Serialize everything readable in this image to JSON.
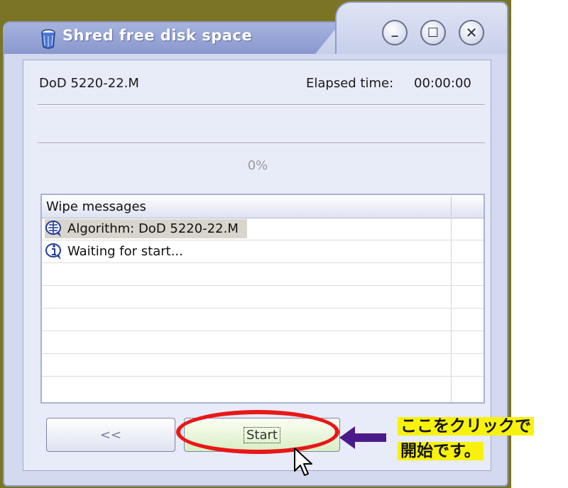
{
  "window": {
    "title": "Shred free disk space",
    "controls": {
      "minimize": "_",
      "maximize": "☐",
      "close": "✕"
    }
  },
  "status": {
    "algorithm": "DoD 5220-22.M",
    "elapsed_label": "Elapsed time:",
    "elapsed_value": "00:00:00",
    "progress_percent_text": "0%",
    "progress_value": 0
  },
  "wipe_messages": {
    "header": "Wipe messages",
    "rows": [
      {
        "icon": "algorithm-icon",
        "text": "Algorithm: DoD 5220-22.M",
        "selected": true
      },
      {
        "icon": "info-icon",
        "text": "Waiting for start...",
        "selected": false
      }
    ]
  },
  "buttons": {
    "back_label": "<<",
    "start_label": "Start"
  },
  "annotation": {
    "line1": "ここをクリックで",
    "line2": "開始です。",
    "highlight_color": "#f8f20a",
    "oval_color": "#e81818",
    "arrow_color": "#4b1a8a"
  },
  "colors": {
    "desktop": "#7a7424",
    "title_bar": "#8997cd",
    "window_body": "#d3d9ef"
  }
}
